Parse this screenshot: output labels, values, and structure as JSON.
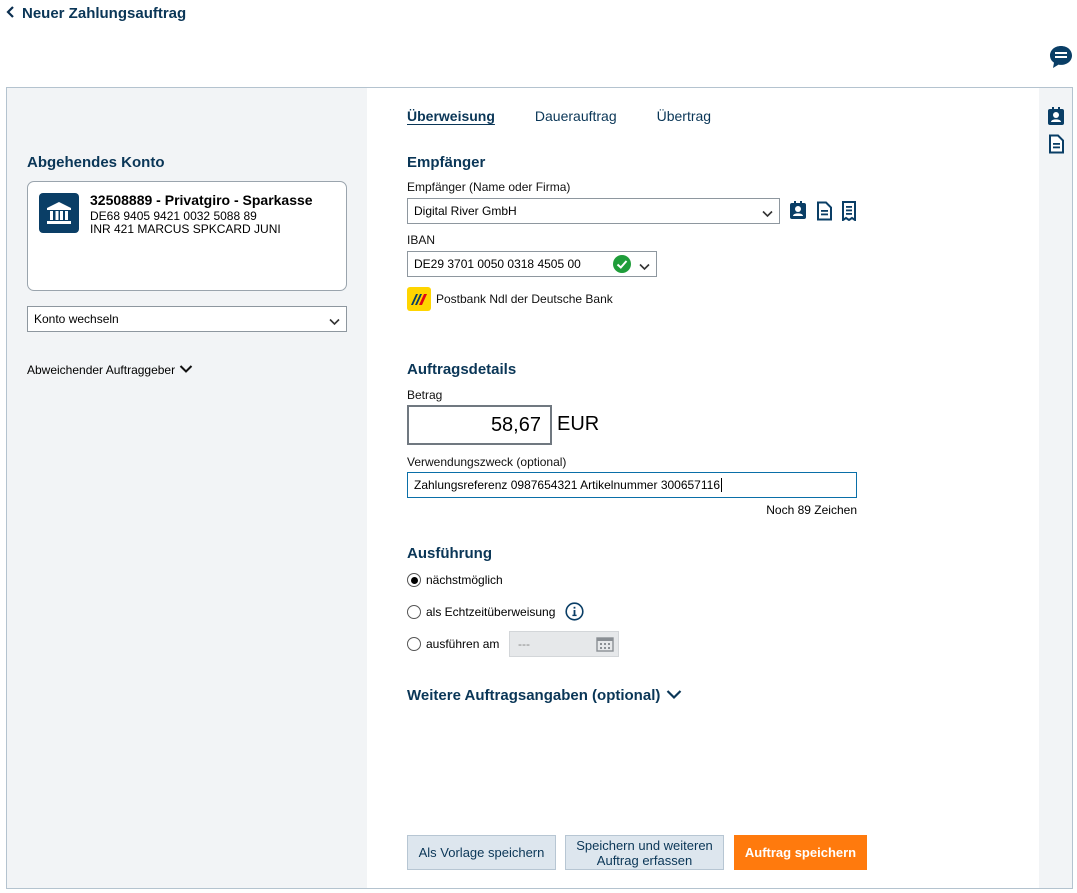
{
  "header": {
    "title": "Neuer Zahlungsauftrag"
  },
  "left": {
    "section_title": "Abgehendes Konto",
    "account": {
      "name": "32508889 - Privatgiro - Sparkasse",
      "iban": "DE68 9405 9421 0032 5088 89",
      "holder": "INR 421 MARCUS SPKCARD JUNI"
    },
    "switch_account": "Konto wechseln",
    "different_payer": "Abweichender Auftraggeber"
  },
  "tabs": [
    {
      "label": "Überweisung",
      "active": true
    },
    {
      "label": "Dauerauftrag",
      "active": false
    },
    {
      "label": "Übertrag",
      "active": false
    }
  ],
  "recipient": {
    "section_title": "Empfänger",
    "name_label": "Empfänger (Name oder Firma)",
    "name_value": "Digital River GmbH",
    "iban_label": "IBAN",
    "iban_value": "DE29 3701 0050 0318 4505 00",
    "bank_name": "Postbank Ndl der Deutsche Bank"
  },
  "details": {
    "section_title": "Auftragsdetails",
    "amount_label": "Betrag",
    "amount_value": "58,67",
    "currency": "EUR",
    "purpose_label": "Verwendungszweck (optional)",
    "purpose_value": "Zahlungsreferenz 0987654321 Artikelnummer 300657116",
    "chars_left": "Noch 89 Zeichen"
  },
  "execution": {
    "section_title": "Ausführung",
    "options": [
      "nächstmöglich",
      "als Echtzeitüberweisung",
      "ausführen am"
    ],
    "selected": "nächstmöglich",
    "date_placeholder": "---"
  },
  "more_details": "Weitere Auftragsangaben (optional)",
  "buttons": {
    "save_template": "Als Vorlage speichern",
    "save_and_new_line1": "Speichern und weiteren",
    "save_and_new_line2": "Auftrag erfassen",
    "save_order": "Auftrag speichern"
  },
  "colors": {
    "brand": "#0a3657",
    "accent": "#ff7a0d",
    "success": "#1f9d3a",
    "panel": "#f2f4f6"
  }
}
